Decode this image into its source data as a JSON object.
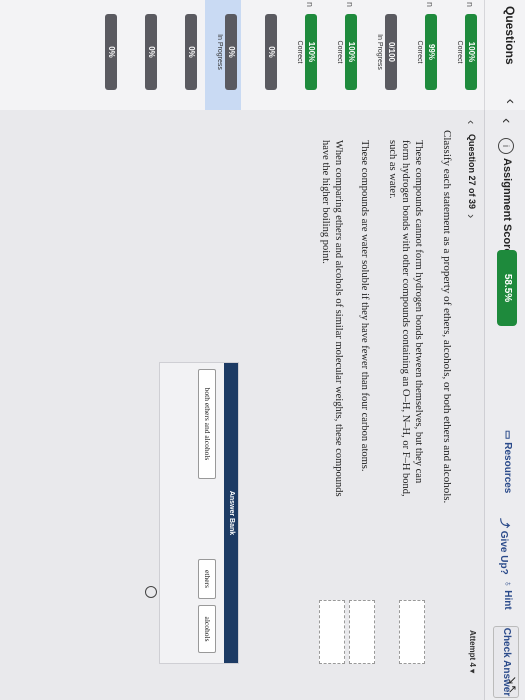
{
  "sidebar": {
    "title": "Questions",
    "collapse_icon": "chevron-left-icon",
    "items": [
      {
        "num": "n",
        "score": "100%",
        "status": "Correct",
        "color": "#1e8a3c"
      },
      {
        "num": "n",
        "score": "99%",
        "status": "Correct",
        "color": "#1e8a3c"
      },
      {
        "num": "",
        "score": "0/100",
        "status": "In Progress",
        "color": "#5a5a60"
      },
      {
        "num": "n",
        "score": "100%",
        "status": "Correct",
        "color": "#1e8a3c"
      },
      {
        "num": "n",
        "score": "100%",
        "status": "Correct",
        "color": "#1e8a3c"
      },
      {
        "num": "",
        "score": "0%",
        "status": "",
        "color": "#5a5a60"
      },
      {
        "num": "",
        "score": "0%",
        "status": "In Progress",
        "color": "#5a5a60"
      },
      {
        "num": "",
        "score": "0%",
        "status": "",
        "color": "#5a5a60"
      },
      {
        "num": "",
        "score": "0%",
        "status": "",
        "color": "#5a5a60"
      },
      {
        "num": "",
        "score": "0%",
        "status": "",
        "color": "#5a5a60"
      }
    ]
  },
  "topbar": {
    "score_label": "Assignment Score:",
    "score_value": "58.5%",
    "resources": "Resources",
    "give_up": "Give Up?",
    "hint": "Hint",
    "check_answer": "Check Answer"
  },
  "qnav": {
    "label": "Question 27 of 39",
    "attempt": "Attempt 4"
  },
  "question": {
    "instructions": "Classify each statement as a property of ethers, alcohols, or both ethers and alcohols.",
    "statements": [
      "These compounds cannot form hydrogen bonds between themselves, but they can form hydrogen bonds with other compounds containing an O–H, N–H, or F–H bond, such as water.",
      "These compounds are water soluble if they have fewer than four carbon atoms.",
      "When comparing ethers and alcohols of similar molecular weights, these compounds have the higher boiling point."
    ]
  },
  "bank": {
    "title": "Answer Bank",
    "chips": [
      "both ethers and alcohols",
      "ethers",
      "alcohols"
    ]
  },
  "colors": {
    "score_green": "#1e8a3c",
    "bank_header": "#1d3b64",
    "active_row": "#c9daf3"
  }
}
